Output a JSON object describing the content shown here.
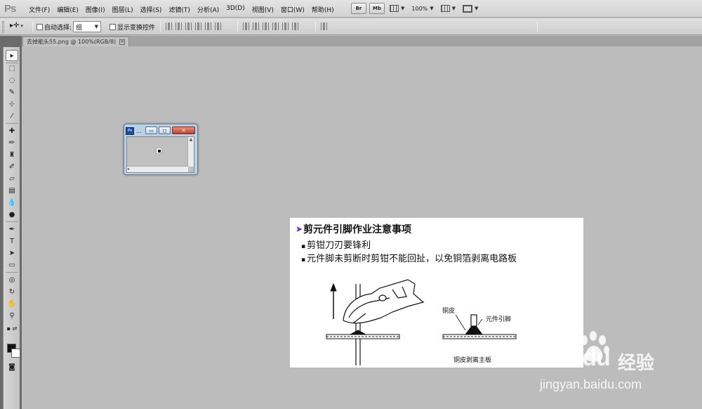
{
  "app": {
    "logo": "Ps"
  },
  "menu": [
    "文件(F)",
    "编辑(E)",
    "图像(I)",
    "图层(L)",
    "选择(S)",
    "滤镜(T)",
    "分析(A)",
    "3D(D)",
    "视图(V)",
    "窗口(W)",
    "帮助(H)"
  ],
  "app_bar": {
    "bridge_label": "Br",
    "minibridge_label": "Mb",
    "zoom": "100%"
  },
  "options_bar": {
    "auto_select_label": "自动选择:",
    "auto_select_value": "组",
    "show_transform_label": "显示变换控件"
  },
  "document": {
    "tab_title": "去掉能头55.png @ 100%(RGB/8)",
    "tab_close": "✕"
  },
  "mini_window": {
    "title_dots": "..."
  },
  "slide": {
    "title": "剪元件引脚作业注意事项",
    "bullets": [
      "剪钳刀刃要锋利",
      "元件脚未剪断时剪钳不能回扯，以免铜箔剥离电路板"
    ],
    "diagram_labels": {
      "copper": "铜皮",
      "lead": "元件引脚",
      "caption": "铜皮剥离主板"
    }
  },
  "watermark": {
    "logo": "Bai du",
    "cn": "经验",
    "url": "jingyan.baidu.com"
  }
}
